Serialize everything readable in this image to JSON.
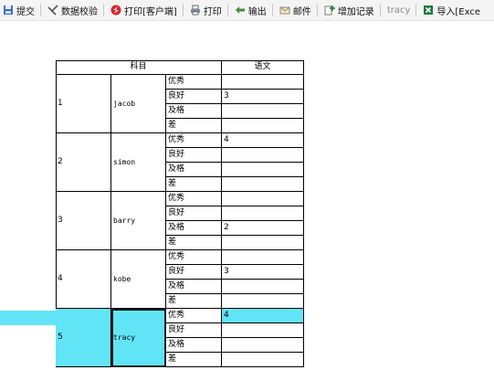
{
  "toolbar": {
    "submit": "提交",
    "validate": "数据校验",
    "print_client": "打印[客户端]",
    "print": "打印",
    "export": "输出",
    "mail": "邮件",
    "add_record": "增加记录",
    "user": "tracy",
    "import_excel": "导入[Exce"
  },
  "table": {
    "header_subject": "科目",
    "header_chinese": "语文",
    "grades": [
      "优秀",
      "良好",
      "及格",
      "差"
    ],
    "students": [
      {
        "id": "1",
        "name": "jacob",
        "scores": [
          "",
          "3",
          "",
          ""
        ]
      },
      {
        "id": "2",
        "name": "simon",
        "scores": [
          "4",
          "",
          "",
          ""
        ]
      },
      {
        "id": "3",
        "name": "barry",
        "scores": [
          "",
          "",
          "2",
          ""
        ]
      },
      {
        "id": "4",
        "name": "kobe",
        "scores": [
          "",
          "3",
          "",
          ""
        ]
      },
      {
        "id": "5",
        "name": "tracy",
        "scores": [
          "4",
          "",
          "",
          ""
        ]
      }
    ]
  },
  "colors": {
    "highlight": "#62e4f7"
  }
}
